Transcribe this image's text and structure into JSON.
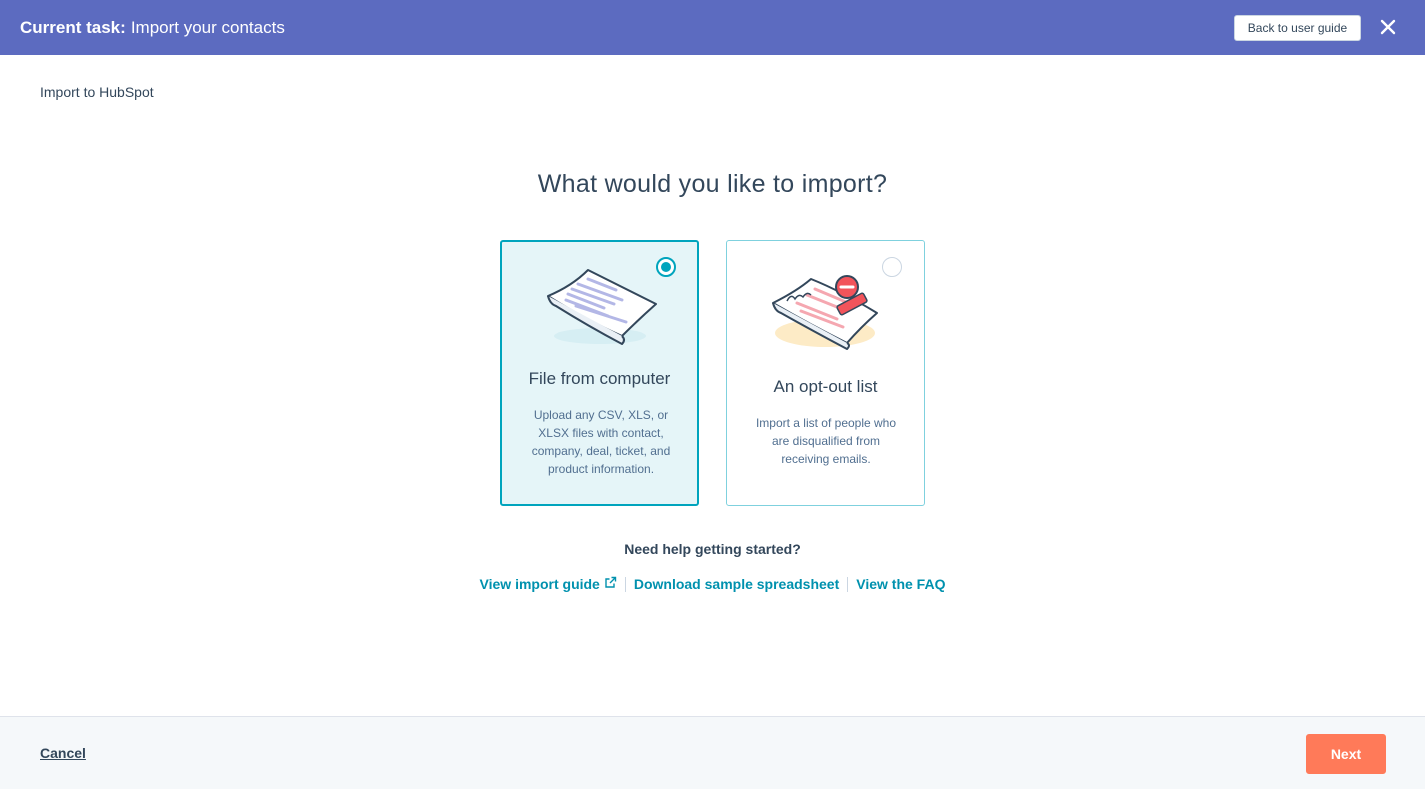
{
  "colors": {
    "taskbar_bg": "#5c6bc0",
    "accent": "#00a4bd",
    "link": "#0091ae",
    "primary_button": "#ff7a59",
    "text": "#33475b"
  },
  "taskbar": {
    "prefix": "Current task:",
    "title": "Import your contacts",
    "back_label": "Back to user guide",
    "close_icon": "close-icon"
  },
  "breadcrumb": "Import to HubSpot",
  "page_title": "What would you like to import?",
  "options": [
    {
      "title": "File from computer",
      "description": "Upload any CSV, XLS, or XLSX files with contact, company, deal, ticket, and product information.",
      "selected": true,
      "icon": "spreadsheet-file-icon"
    },
    {
      "title": "An opt-out list",
      "description": "Import a list of people who are disqualified from receiving emails.",
      "selected": false,
      "icon": "opt-out-document-icon"
    }
  ],
  "help": {
    "title": "Need help getting started?",
    "links": {
      "guide": "View import guide",
      "sample": "Download sample spreadsheet",
      "faq": "View the FAQ"
    },
    "external_icon": "external-link-icon"
  },
  "footer": {
    "cancel_label": "Cancel",
    "next_label": "Next"
  }
}
